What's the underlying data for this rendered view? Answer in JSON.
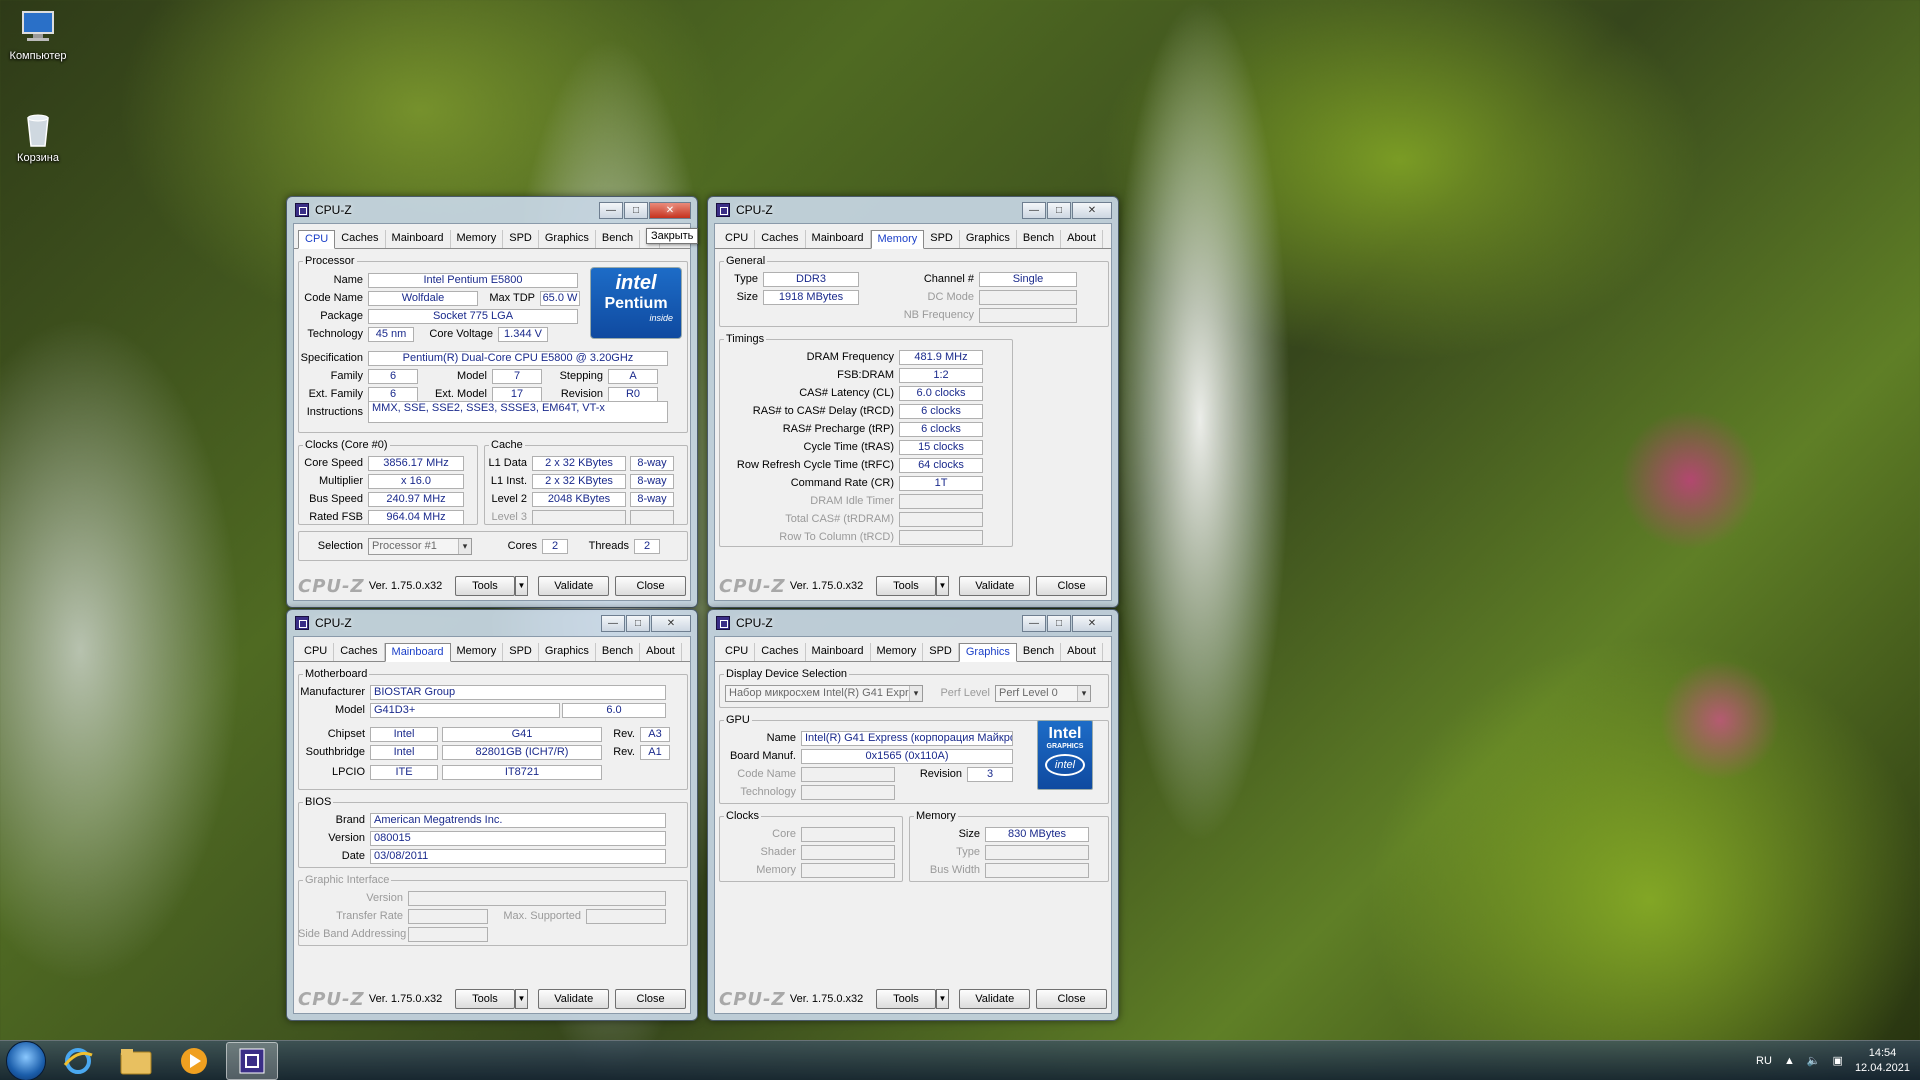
{
  "desktop": {
    "icons": [
      "Компьютер",
      "Корзина"
    ]
  },
  "tooltip": "Закрыть",
  "windows": {
    "title": "CPU-Z",
    "tabs": [
      "CPU",
      "Caches",
      "Mainboard",
      "Memory",
      "SPD",
      "Graphics",
      "Bench",
      "About"
    ],
    "cpu_tabs": [
      "CPU",
      "Caches",
      "Mainboard",
      "Memory",
      "SPD",
      "Graphics",
      "Bench",
      "A"
    ],
    "footer": {
      "brand": "CPU-Z",
      "version": "Ver. 1.75.0.x32",
      "tools": "Tools",
      "validate": "Validate",
      "close": "Close"
    }
  },
  "cpu": {
    "processor_legend": "Processor",
    "name_label": "Name",
    "name": "Intel Pentium E5800",
    "codename_label": "Code Name",
    "codename": "Wolfdale",
    "maxtdp_label": "Max TDP",
    "maxtdp": "65.0 W",
    "package_label": "Package",
    "package": "Socket 775 LGA",
    "technology_label": "Technology",
    "technology": "45 nm",
    "corevoltage_label": "Core Voltage",
    "corevoltage": "1.344 V",
    "spec_label": "Specification",
    "spec": "Pentium(R) Dual-Core  CPU     E5800  @ 3.20GHz",
    "family_label": "Family",
    "family": "6",
    "model_label": "Model",
    "model": "7",
    "stepping_label": "Stepping",
    "stepping": "A",
    "extfamily_label": "Ext. Family",
    "extfamily": "6",
    "extmodel_label": "Ext. Model",
    "extmodel": "17",
    "revision_label": "Revision",
    "revision": "R0",
    "instructions_label": "Instructions",
    "instructions": "MMX, SSE, SSE2, SSE3, SSSE3, EM64T, VT-x",
    "clocks_legend": "Clocks (Core #0)",
    "corespeed_label": "Core Speed",
    "corespeed": "3856.17 MHz",
    "multiplier_label": "Multiplier",
    "multiplier": "x 16.0",
    "busspeed_label": "Bus Speed",
    "busspeed": "240.97 MHz",
    "ratedfsb_label": "Rated FSB",
    "ratedfsb": "964.04 MHz",
    "cache_legend": "Cache",
    "l1data_label": "L1 Data",
    "l1data": "2 x 32 KBytes",
    "l1data_way": "8-way",
    "l1inst_label": "L1 Inst.",
    "l1inst": "2 x 32 KBytes",
    "l1inst_way": "8-way",
    "level2_label": "Level 2",
    "level2": "2048 KBytes",
    "level2_way": "8-way",
    "level3_label": "Level 3",
    "selection_label": "Selection",
    "selection": "Processor #1",
    "cores_label": "Cores",
    "cores": "2",
    "threads_label": "Threads",
    "threads": "2",
    "logo_top": "intel",
    "logo_mid": "Pentium",
    "logo_bot": "inside"
  },
  "memory": {
    "general_legend": "General",
    "type_label": "Type",
    "type": "DDR3",
    "size_label": "Size",
    "size": "1918 MBytes",
    "channel_label": "Channel #",
    "channel": "Single",
    "dcmode_label": "DC Mode",
    "nbfreq_label": "NB Frequency",
    "timings_legend": "Timings",
    "timings": [
      {
        "label": "DRAM Frequency",
        "value": "481.9 MHz",
        "dis": false
      },
      {
        "label": "FSB:DRAM",
        "value": "1:2",
        "dis": false
      },
      {
        "label": "CAS# Latency (CL)",
        "value": "6.0 clocks",
        "dis": false
      },
      {
        "label": "RAS# to CAS# Delay (tRCD)",
        "value": "6 clocks",
        "dis": false
      },
      {
        "label": "RAS# Precharge (tRP)",
        "value": "6 clocks",
        "dis": false
      },
      {
        "label": "Cycle Time (tRAS)",
        "value": "15 clocks",
        "dis": false
      },
      {
        "label": "Row Refresh Cycle Time (tRFC)",
        "value": "64 clocks",
        "dis": false
      },
      {
        "label": "Command Rate (CR)",
        "value": "1T",
        "dis": false
      },
      {
        "label": "DRAM Idle Timer",
        "value": "",
        "dis": true
      },
      {
        "label": "Total CAS# (tRDRAM)",
        "value": "",
        "dis": true
      },
      {
        "label": "Row To Column (tRCD)",
        "value": "",
        "dis": true
      }
    ]
  },
  "mainboard": {
    "mb_legend": "Motherboard",
    "manufacturer_label": "Manufacturer",
    "manufacturer": "BIOSTAR Group",
    "model_label": "Model",
    "model": "G41D3+",
    "model_rev": "6.0",
    "chipset_label": "Chipset",
    "chipset_vendor": "Intel",
    "chipset": "G41",
    "chipset_rev_label": "Rev.",
    "chipset_rev": "A3",
    "southbridge_label": "Southbridge",
    "sb_vendor": "Intel",
    "sb": "82801GB (ICH7/R)",
    "sb_rev_label": "Rev.",
    "sb_rev": "A1",
    "lpcio_label": "LPCIO",
    "lpcio_vendor": "ITE",
    "lpcio": "IT8721",
    "bios_legend": "BIOS",
    "brand_label": "Brand",
    "brand": "American Megatrends Inc.",
    "version_label": "Version",
    "version": "080015",
    "date_label": "Date",
    "date": "03/08/2011",
    "gi_legend": "Graphic Interface",
    "gi_version_label": "Version",
    "gi_transfer_label": "Transfer Rate",
    "gi_max_label": "Max. Supported",
    "gi_sideband_label": "Side Band Addressing"
  },
  "graphics": {
    "dds_legend": "Display Device Selection",
    "device": "Набор микросхем Intel(R) G41 Expre",
    "perflevel_label": "Perf Level",
    "perflevel": "Perf Level 0",
    "gpu_legend": "GPU",
    "name_label": "Name",
    "name": "Intel(R) G41 Express (корпорация Майкро",
    "boardmanuf_label": "Board Manuf.",
    "boardmanuf": "0x1565 (0x110A)",
    "codename_label": "Code Name",
    "revision_label": "Revision",
    "revision": "3",
    "technology_label": "Technology",
    "clocks_legend": "Clocks",
    "core_label": "Core",
    "shader_label": "Shader",
    "memory_label": "Memory",
    "memory_legend": "Memory",
    "size_label": "Size",
    "size": "830 MBytes",
    "type_label": "Type",
    "buswidth_label": "Bus Width",
    "logo_top": "Intel",
    "logo_mid": "GRAPHICS",
    "logo_bot": "intel"
  },
  "taskbar": {
    "lang": "RU",
    "time": "14:54",
    "date": "12.04.2021"
  }
}
